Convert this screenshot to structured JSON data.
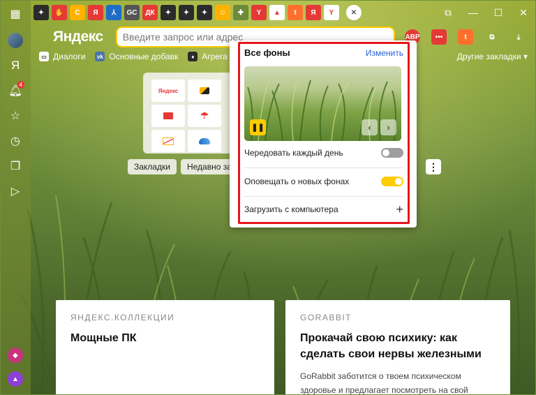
{
  "window": {
    "minimize": "—",
    "maximize": "☐",
    "close": "✕"
  },
  "tabs": [
    {
      "icon": "star-tab-icon",
      "glyph": "✦",
      "bg": "#2b2b2b"
    },
    {
      "icon": "hand-tab-icon",
      "glyph": "✋",
      "bg": "#e53935"
    },
    {
      "icon": "c-tab-icon",
      "glyph": "C",
      "bg": "#ffb300"
    },
    {
      "icon": "yandex-tab-icon",
      "glyph": "Я",
      "bg": "#e53935"
    },
    {
      "icon": "pdf-tab-icon",
      "glyph": "⅄",
      "bg": "#1e6ec8"
    },
    {
      "icon": "gc-tab-icon",
      "glyph": "GC",
      "bg": "#555"
    },
    {
      "icon": "dk-tab-icon",
      "glyph": "ДК",
      "bg": "#e53935"
    },
    {
      "icon": "star-tab-icon-2",
      "glyph": "✦",
      "bg": "#2b2b2b"
    },
    {
      "icon": "star-tab-icon-3",
      "glyph": "✦",
      "bg": "#2b2b2b"
    },
    {
      "icon": "star-tab-icon-4",
      "glyph": "✦",
      "bg": "#2b2b2b"
    },
    {
      "icon": "emoji-tab-icon",
      "glyph": "☺",
      "bg": "#ffb300"
    },
    {
      "icon": "puzzle-tab-icon",
      "glyph": "✚",
      "bg": "#6d8a3a"
    },
    {
      "icon": "yandex-browser-tab-icon",
      "glyph": "Y",
      "bg": "#e53935"
    },
    {
      "icon": "market-tab-icon",
      "glyph": "▲",
      "bg": "#fff"
    },
    {
      "icon": "t-tab-icon",
      "glyph": "t",
      "bg": "#ff6f2c"
    },
    {
      "icon": "ya-tab-icon",
      "glyph": "Я",
      "bg": "#e53935"
    },
    {
      "icon": "y-tab-icon",
      "glyph": "Y",
      "bg": "#fff"
    },
    {
      "icon": "close-tab-icon",
      "glyph": "✕",
      "bg": "#fff"
    }
  ],
  "toolbar": {
    "logo": "Яндекс",
    "search_placeholder": "Введите запрос или адрес"
  },
  "bookmarks": [
    {
      "label": "Диалоги",
      "icon": "dialogs-icon",
      "glyph": "▭",
      "bg": "#fff"
    },
    {
      "label": "Основные добавк",
      "icon": "vk-icon",
      "glyph": "vk",
      "bg": "#4a76a8"
    },
    {
      "label": "Агрега",
      "icon": "agg-icon",
      "glyph": "♦",
      "bg": "#2b2b2b"
    }
  ],
  "bookmarks_other": "Другие закладки ▾",
  "chips": [
    "Закладки",
    "Недавно зак"
  ],
  "popup": {
    "title": "Все фоны",
    "edit": "Изменить",
    "pause": "❚❚",
    "prev": "‹",
    "next": "›",
    "options": [
      {
        "label": "Чередовать каждый день",
        "on": false
      },
      {
        "label": "Оповещать о новых фонах",
        "on": true
      },
      {
        "label": "Загрузить с компьютера"
      }
    ],
    "plus": "+"
  },
  "cards": [
    {
      "source": "ЯНДЕКС.КОЛЛЕКЦИИ",
      "title": "Мощные ПК",
      "text": ""
    },
    {
      "source": "GORABBIT",
      "title": "Прокачай свою психику: как сделать свои нервы железными",
      "text": "GoRabbit заботится о твоем психическом здоровье и предлагает посмотреть на свой"
    }
  ],
  "sidebar_badge": "4",
  "colors": {
    "accent": "#ffcc00",
    "highlight": "#e8141b",
    "link": "#2a62d8"
  }
}
